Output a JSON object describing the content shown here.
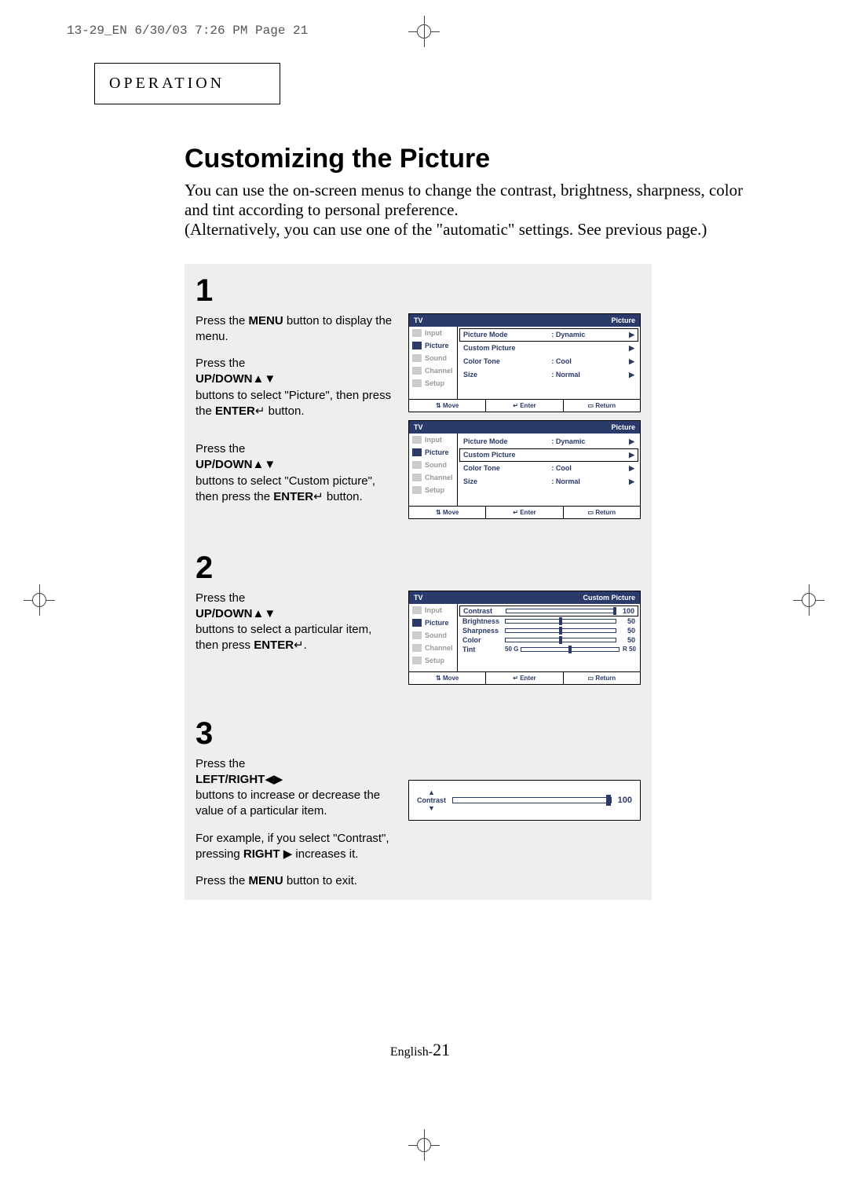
{
  "print_header": "13-29_EN  6/30/03 7:26 PM  Page 21",
  "section_label": "OPERATION",
  "title": "Customizing the Picture",
  "intro_line1": "You can use the on-screen menus to change the contrast, brightness, sharpness, color and tint according to personal preference.",
  "intro_line2": "(Alternatively, you can use one of the \"automatic\" settings. See previous page.)",
  "step1_num": "1",
  "step1a_p1_a": "Press the ",
  "step1a_p1_b": "MENU",
  "step1a_p2": "button to display the menu.",
  "step1b_p1": "Press the",
  "step1b_p2a": "UP/DOWN",
  "step1b_p2b": "▲▼",
  "step1b_p3a": "buttons to select \"Picture\", then press the ",
  "step1b_p3b": "ENTER",
  "step1b_p3c": " button.",
  "step1c_p1": "Press the",
  "step1c_p2a": "UP/DOWN",
  "step1c_p2b": "▲▼",
  "step1c_p3a": "buttons to select \"Custom picture\", then press the ",
  "step1c_p3b": "ENTER",
  "step1c_p3c": " button.",
  "step2_num": "2",
  "step2_p1": "Press the",
  "step2_p2a": "UP/DOWN",
  "step2_p2b": "▲▼",
  "step2_p3a": "buttons to select a particular item, then press ",
  "step2_p3b": "ENTER",
  "step2_p3c": ".",
  "step3_num": "3",
  "step3_p1": "Press the",
  "step3_p2a": "LEFT/RIGHT",
  "step3_p2b": "◀▶",
  "step3_p3": "buttons to increase or decrease the value of a particular item.",
  "step3_p4a": "For example, if you select \"Contrast\", pressing ",
  "step3_p4b": "RIGHT",
  "step3_p4c": " ▶ increases it.",
  "step3_p5a": "Press the ",
  "step3_p5b": "MENU",
  "step3_p5c": " button to exit.",
  "osd": {
    "tv": "TV",
    "picture": "Picture",
    "custom_picture_title": "Custom Picture",
    "sidebar": [
      "Input",
      "Picture",
      "Sound",
      "Channel",
      "Setup"
    ],
    "rows1": [
      {
        "k": "Picture Mode",
        "v": ": Dynamic"
      },
      {
        "k": "Custom Picture",
        "v": ""
      },
      {
        "k": "Color Tone",
        "v": ": Cool"
      },
      {
        "k": "Size",
        "v": ": Normal"
      }
    ],
    "footer": {
      "move": "⇅ Move",
      "enter": "↵ Enter",
      "return": "▭ Return"
    },
    "sliders": [
      {
        "k": "Contrast",
        "val": "100",
        "pos": 100
      },
      {
        "k": "Brightness",
        "val": "50",
        "pos": 50
      },
      {
        "k": "Sharpness",
        "val": "50",
        "pos": 50
      },
      {
        "k": "Color",
        "val": "50",
        "pos": 50
      }
    ],
    "tint": {
      "k": "Tint",
      "leftLabel": "G",
      "leftVal": "50",
      "rightLabel": "R",
      "rightVal": "50",
      "pos": 50
    }
  },
  "adjust": {
    "label": "Contrast",
    "value": "100"
  },
  "page_prefix": "English-",
  "page_num": "21",
  "enter_icon": "↵"
}
